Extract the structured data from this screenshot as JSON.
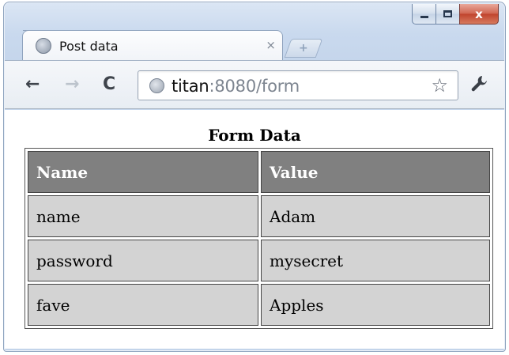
{
  "window": {
    "controls": {
      "minimize_icon": "minimize-icon",
      "maximize_icon": "maximize-icon",
      "close_glyph": "x"
    }
  },
  "tab": {
    "title": "Post data",
    "close_glyph": "×",
    "new_tab_glyph": "+"
  },
  "toolbar": {
    "back_glyph": "←",
    "forward_glyph": "→",
    "reload_glyph": "C",
    "url_host": "titan",
    "url_rest": ":8080/form",
    "star_glyph": "☆",
    "wrench_glyph": "🔧"
  },
  "page": {
    "title": "Form Data",
    "table": {
      "headers": [
        "Name",
        "Value"
      ],
      "rows": [
        [
          "name",
          "Adam"
        ],
        [
          "password",
          "mysecret"
        ],
        [
          "fave",
          "Apples"
        ]
      ]
    }
  },
  "colors": {
    "header_bg": "#808080",
    "cell_bg": "#d3d3d3",
    "close_button": "#c0432d"
  }
}
